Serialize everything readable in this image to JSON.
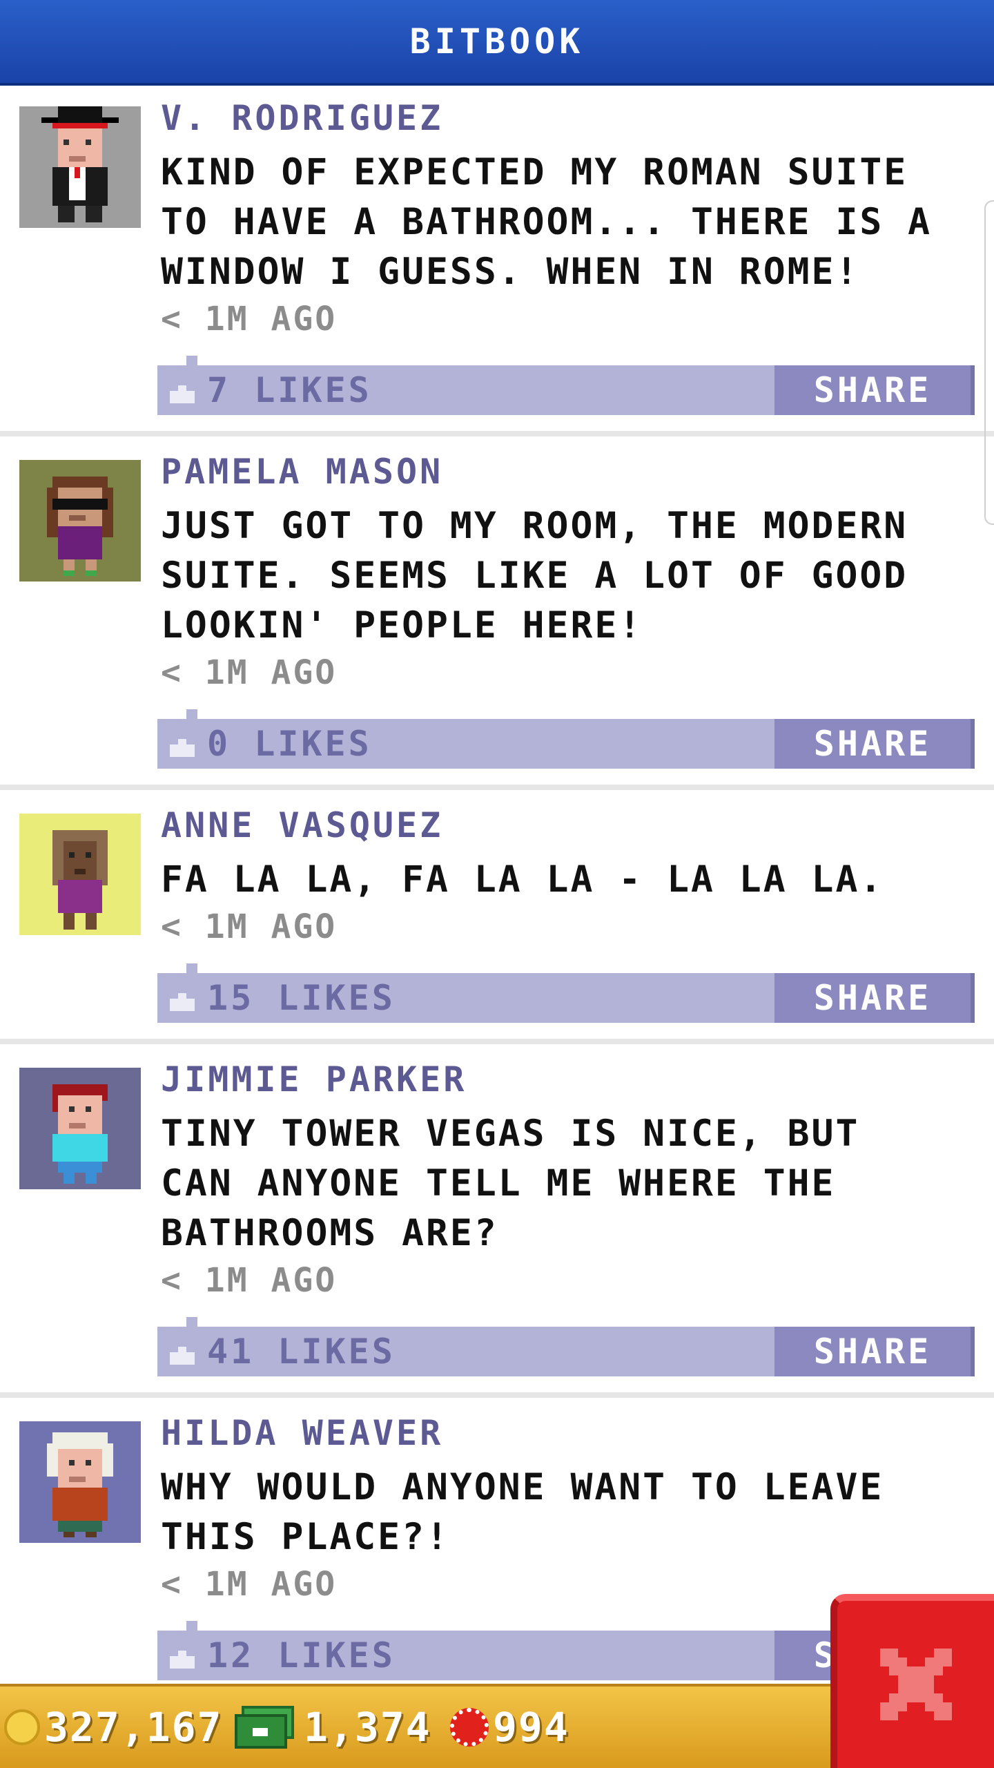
{
  "header": {
    "title": "BITBOOK"
  },
  "posts": [
    {
      "name": "V. RODRIGUEZ",
      "message": "KIND OF EXPECTED MY ROMAN SUITE TO HAVE A BATHROOM... THERE IS A WINDOW I GUESS. WHEN IN ROME!",
      "time": "< 1M AGO",
      "likes": "7 LIKES",
      "share": "SHARE",
      "avatar_bg": "#9e9e9e"
    },
    {
      "name": "PAMELA MASON",
      "message": "JUST GOT TO MY ROOM, THE MODERN SUITE. SEEMS LIKE A LOT OF GOOD LOOKIN' PEOPLE HERE!",
      "time": "< 1M AGO",
      "likes": "0 LIKES",
      "share": "SHARE",
      "avatar_bg": "#7e8448"
    },
    {
      "name": "ANNE VASQUEZ",
      "message": "FA LA LA, FA LA LA - LA LA LA.",
      "time": "< 1M AGO",
      "likes": "15 LIKES",
      "share": "SHARE",
      "avatar_bg": "#eaec7a"
    },
    {
      "name": "JIMMIE PARKER",
      "message": "TINY TOWER VEGAS IS NICE, BUT CAN ANYONE TELL ME WHERE THE BATHROOMS ARE?",
      "time": "< 1M AGO",
      "likes": "41 LIKES",
      "share": "SHARE",
      "avatar_bg": "#6b6a94"
    },
    {
      "name": "HILDA WEAVER",
      "message": "WHY WOULD ANYONE WANT TO LEAVE THIS PLACE?!",
      "time": "< 1M AGO",
      "likes": "12 LIKES",
      "share": "SHARE",
      "avatar_bg": "#7173b0"
    }
  ],
  "footer": {
    "coins": "327,167",
    "bux": "1,374",
    "chips": "994"
  },
  "colors": {
    "header_blue": "#2a5fc9",
    "name_purple": "#5d5a93",
    "bar_lavender": "#b3b3d7",
    "share_purple": "#8b89bf",
    "footer_gold": "#f2c447",
    "close_red": "#e11f22"
  }
}
